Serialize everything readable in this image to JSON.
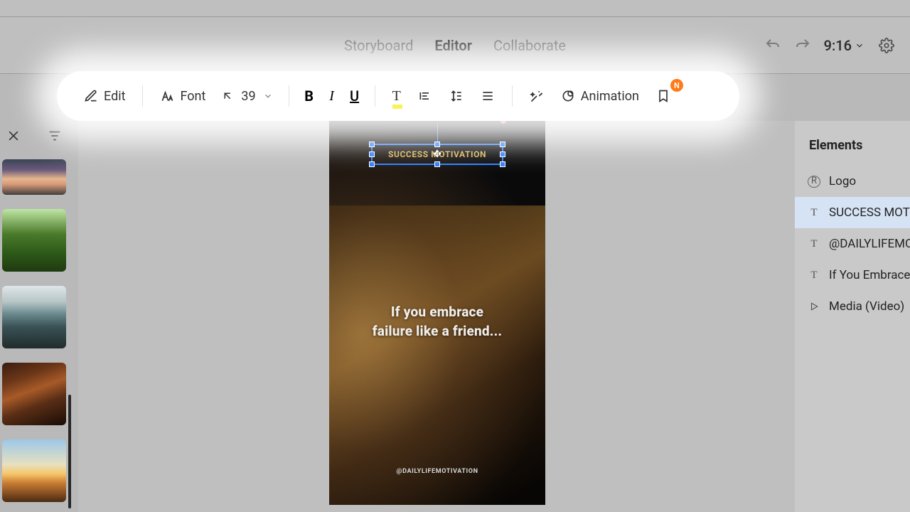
{
  "nav": {
    "tabs": [
      "Storyboard",
      "Editor",
      "Collaborate"
    ],
    "active_index": 1,
    "time": "9:16"
  },
  "toolbar": {
    "edit": "Edit",
    "font": "Font",
    "font_size": "39",
    "animation": "Animation",
    "badge": "N"
  },
  "canvas": {
    "title_text": "SUCCESS MOTIVATION",
    "caption_line1": "If you embrace",
    "caption_line2": "failure like a friend...",
    "handle_text": "@DAILYLIFEMOTIVATION"
  },
  "elements": {
    "header": "Elements",
    "items": [
      {
        "kind": "logo",
        "label": "Logo"
      },
      {
        "kind": "text",
        "label": "SUCCESS MOTIVATION",
        "selected": true
      },
      {
        "kind": "text",
        "label": "@DAILYLIFEMOTIVATION"
      },
      {
        "kind": "text",
        "label": "If You Embrace Failure"
      },
      {
        "kind": "media",
        "label": "Media (Video)"
      }
    ]
  }
}
